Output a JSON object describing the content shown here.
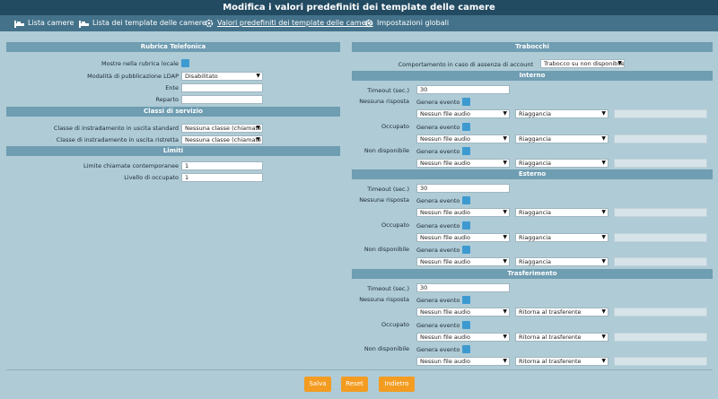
{
  "title": "Modifica i valori predefiniti dei template delle camere",
  "nav": [
    {
      "label": "Lista camere"
    },
    {
      "label": "Lista dei template delle camere"
    },
    {
      "label": "Valori predefiniti dei template delle camere"
    },
    {
      "label": "Impostazioni globali"
    }
  ],
  "left": {
    "rubrica": {
      "header": "Rubrica Telefonica",
      "mostra_label": "Mostre nella rubrica locale",
      "ldap_label": "Modalità di pubblicazione LDAP",
      "ldap_value": "Disabilitato",
      "ente_label": "Ente",
      "reparto_label": "Reparto"
    },
    "classi": {
      "header": "Classi di servizio",
      "standard_label": "Classe di instradamento in uscita standard",
      "standard_value": "Nessuna classe (chiamate u",
      "ristretta_label": "Classe di instradamento in uscita ristretta",
      "ristretta_value": "Nessuna classe (chiamate u"
    },
    "limiti": {
      "header": "Limiti",
      "chiamate_label": "Limite chiamate contemporanee",
      "chiamate_value": "1",
      "occupato_label": "Livello di occupato",
      "occupato_value": "1"
    }
  },
  "right": {
    "trabocchi_header": "Trabocchi",
    "comportamento_label": "Comportamento in caso di assenza di account",
    "comportamento_value": "Trabocco su non disponibile",
    "sections": [
      {
        "header": "Interno",
        "timeout_label": "Timeout (sec.)",
        "timeout_value": "30",
        "rows": [
          {
            "label": "Nessuna risposta",
            "evento": "Genera evento",
            "audio": "Nessun file audio",
            "azione": "Riaggancia"
          },
          {
            "label": "Occupato",
            "evento": "Genera evento",
            "audio": "Nessun file audio",
            "azione": "Riaggancia"
          },
          {
            "label": "Non disponibile",
            "evento": "Genera evento",
            "audio": "Nessun file audio",
            "azione": "Riaggancia"
          }
        ]
      },
      {
        "header": "Esterno",
        "timeout_label": "Timeout (sec.)",
        "timeout_value": "30",
        "rows": [
          {
            "label": "Nessuna risposta",
            "evento": "Genera evento",
            "audio": "Nessun file audio",
            "azione": "Riaggancia"
          },
          {
            "label": "Occupato",
            "evento": "Genera evento",
            "audio": "Nessun file audio",
            "azione": "Riaggancia"
          },
          {
            "label": "Non disponibile",
            "evento": "Genera evento",
            "audio": "Nessun file audio",
            "azione": "Riaggancia"
          }
        ]
      },
      {
        "header": "Trasferimento",
        "timeout_label": "Timeout (sec.)",
        "timeout_value": "30",
        "rows": [
          {
            "label": "Nessuna risposta",
            "evento": "Genera evento",
            "audio": "Nessun file audio",
            "azione": "Ritorna al trasferente"
          },
          {
            "label": "Occupato",
            "evento": "Genera evento",
            "audio": "Nessun file audio",
            "azione": "Ritorna al trasferente"
          },
          {
            "label": "Non disponibile",
            "evento": "Genera evento",
            "audio": "Nessun file audio",
            "azione": "Ritorna al trasferente"
          }
        ]
      }
    ]
  },
  "buttons": {
    "save": "Salva",
    "reset": "Reset",
    "back": "Indietro"
  },
  "colors": {
    "title_bg": "#224a61",
    "nav_bg": "#44728a",
    "section_bg": "#6f9db1",
    "page_bg": "#aecbd6",
    "checkbox": "#3d9ad1",
    "button": "#f39c21"
  }
}
